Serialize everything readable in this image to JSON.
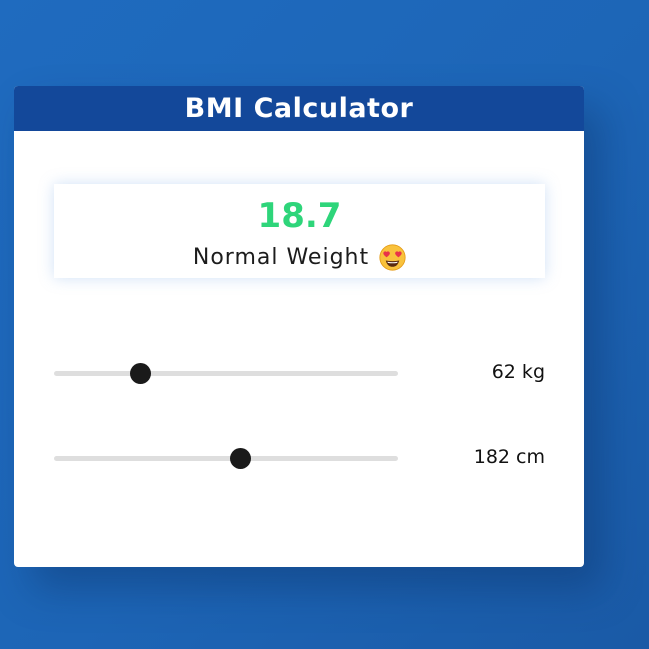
{
  "header": {
    "title": "BMI Calculator"
  },
  "result": {
    "bmi": "18.7",
    "status": "Normal Weight",
    "status_icon": "heart-eyes-emoji-icon",
    "value_color": "#2ed57a"
  },
  "sliders": {
    "weight": {
      "value_label": "62 kg",
      "position_fraction": 0.25
    },
    "height": {
      "value_label": "182 cm",
      "position_fraction": 0.54
    }
  },
  "colors": {
    "background": "#1f6bbf",
    "header": "#13489a",
    "thumb": "#1a1a1a",
    "track": "#dedede"
  }
}
